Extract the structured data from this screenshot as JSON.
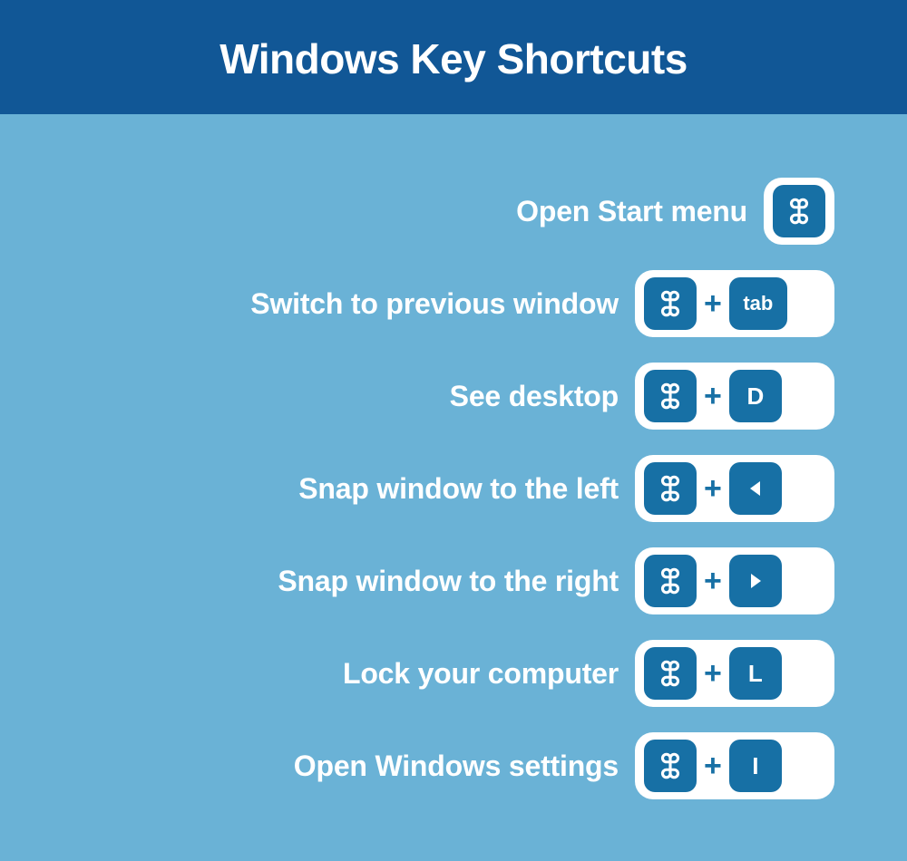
{
  "header": {
    "title": "Windows Key Shortcuts"
  },
  "plus": "+",
  "shortcuts": [
    {
      "label": "Open Start menu",
      "keys": [
        "cmd"
      ]
    },
    {
      "label": "Switch to previous window",
      "keys": [
        "cmd",
        "tab"
      ]
    },
    {
      "label": "See desktop",
      "keys": [
        "cmd",
        "D"
      ]
    },
    {
      "label": "Snap window to the left",
      "keys": [
        "cmd",
        "left"
      ]
    },
    {
      "label": "Snap window to the right",
      "keys": [
        "cmd",
        "right"
      ]
    },
    {
      "label": "Lock your computer",
      "keys": [
        "cmd",
        "L"
      ]
    },
    {
      "label": "Open Windows settings",
      "keys": [
        "cmd",
        "I"
      ]
    }
  ],
  "key_display": {
    "tab": "tab",
    "D": "D",
    "L": "L",
    "I": "I"
  }
}
